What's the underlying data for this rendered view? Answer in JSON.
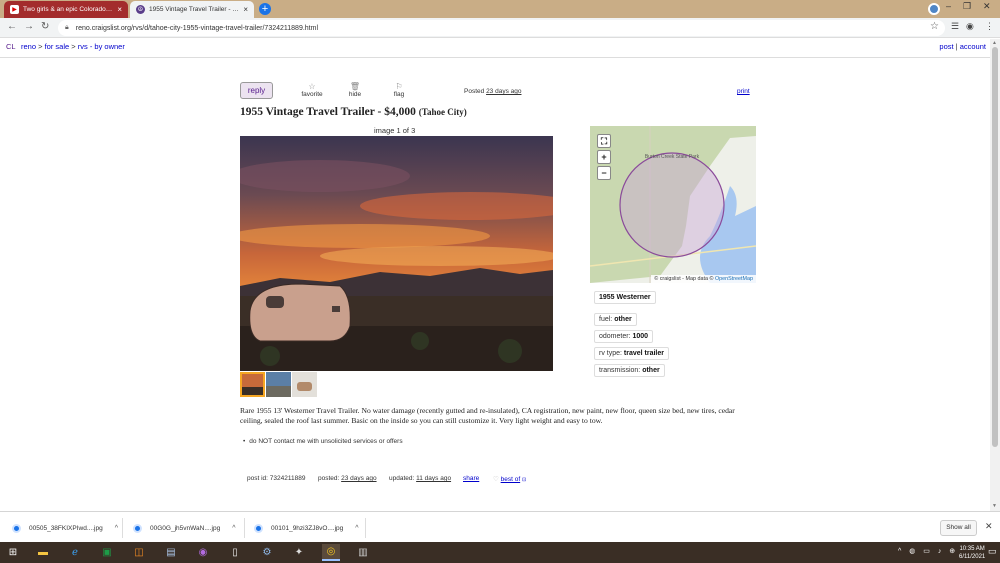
{
  "browser": {
    "tabs": [
      {
        "title": "Two girls & an epic Colorado ad...",
        "icon": "youtube-icon",
        "active": false
      },
      {
        "title": "1955 Vintage Travel Trailer - rvs ...",
        "icon": "peace-sign-icon",
        "active": true
      }
    ],
    "url": "reno.craigslist.org/rvs/d/tahoe-city-1955-vintage-travel-trailer/7324211889.html"
  },
  "cl_header": {
    "logo": "CL",
    "crumbs": [
      "reno",
      "for sale",
      "rvs - by owner"
    ],
    "post": "post",
    "account": "account"
  },
  "posting": {
    "reply": "reply",
    "favorite": "favorite",
    "hide": "hide",
    "flag": "flag",
    "posted_label": "Posted",
    "posted_ago": "23 days ago",
    "print": "print",
    "title": "1955 Vintage Travel Trailer - $4,000",
    "location": "(Tahoe City)",
    "image_counter": "image 1 of 3",
    "attributes_title": "1955 Westerner",
    "attributes": [
      {
        "label": "fuel:",
        "value": "other"
      },
      {
        "label": "odometer:",
        "value": "1000"
      },
      {
        "label": "rv type:",
        "value": "travel trailer"
      },
      {
        "label": "transmission:",
        "value": "other"
      }
    ],
    "body": "Rare 1955 13' Westerner Travel Trailer. No water damage (recently gutted and re-insulated), CA registration, new paint, new floor, queen size bed, new tires, cedar ceiling, sealed the roof last summer. Basic on the inside so you can still customize it. Very light weight and easy to tow.",
    "notice": "do NOT contact me with unsolicited services or offers",
    "post_id_label": "post id:",
    "post_id": "7324211889",
    "posted_footer_label": "posted:",
    "posted_footer": "23 days ago",
    "updated_label": "updated:",
    "updated": "11 days ago",
    "share": "share",
    "best_of": "best of"
  },
  "map": {
    "place_label": "Burton Creek State Park",
    "attribution_prefix": "© craigslist - Map data ©",
    "attribution_link": "OpenStreetMap"
  },
  "downloads": {
    "files": [
      "00505_38FKIXPIwd....jpg",
      "00G0G_jh5vnWaN....jpg",
      "00101_9hzi3ZJ8vO....jpg"
    ],
    "show_all": "Show all"
  },
  "taskbar": {
    "time": "10:35 AM",
    "date": "6/11/2021"
  },
  "colors": {
    "tab_strip": "#c9ad86",
    "link": "#0000cc",
    "visited": "#551a8b",
    "taskbar": "#3a2e25"
  }
}
